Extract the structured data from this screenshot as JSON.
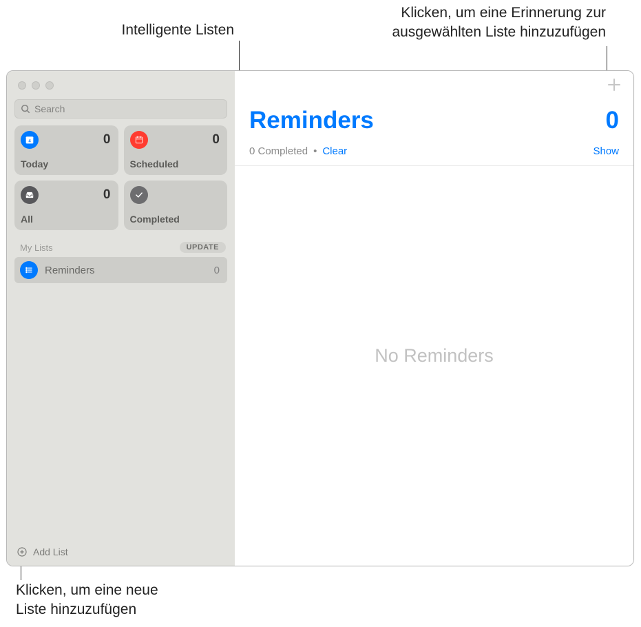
{
  "callouts": {
    "smart_lists": "Intelligente Listen",
    "add_reminder": "Klicken, um eine Erinnerung zur\nausgewählten Liste hinzuzufügen",
    "add_list": "Klicken, um eine neue\nListe hinzuzufügen"
  },
  "sidebar": {
    "search_placeholder": "Search",
    "smart": {
      "today": {
        "label": "Today",
        "count": "0"
      },
      "scheduled": {
        "label": "Scheduled",
        "count": "0"
      },
      "all": {
        "label": "All",
        "count": "0"
      },
      "completed": {
        "label": "Completed"
      }
    },
    "mylists_header": "My Lists",
    "update_button": "UPDATE",
    "lists": [
      {
        "name": "Reminders",
        "count": "0"
      }
    ],
    "add_list_label": "Add List"
  },
  "main": {
    "title": "Reminders",
    "count": "0",
    "completed_text": "0 Completed",
    "clear": "Clear",
    "show": "Show",
    "empty": "No Reminders"
  }
}
